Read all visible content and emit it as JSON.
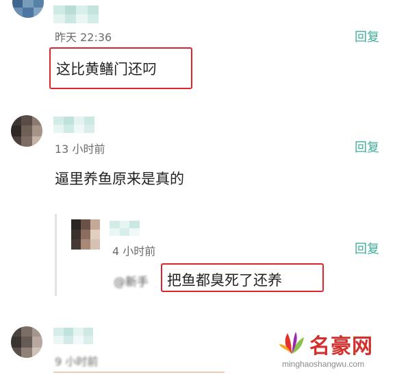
{
  "comments": [
    {
      "time": "昨天 22:36",
      "reply_label": "回复",
      "content": "这比黄鳝门还叼",
      "highlighted": true
    },
    {
      "time": "13 小时前",
      "reply_label": "回复",
      "content": "逼里养鱼原来是真的",
      "highlighted": false,
      "sub_reply": {
        "time": "4 小时前",
        "reply_label": "回复",
        "mention": "@新手",
        "content": "把鱼都臭死了还养",
        "highlighted": true
      }
    },
    {
      "time": "9 小时前",
      "reply_label": "",
      "content": ""
    }
  ],
  "watermark": {
    "name": "名豪网",
    "url": "minghaoshangwu.com"
  },
  "colors": {
    "reply": "#3fae9b",
    "highlight": "#e0222c",
    "brand_red": "#d2302c"
  }
}
